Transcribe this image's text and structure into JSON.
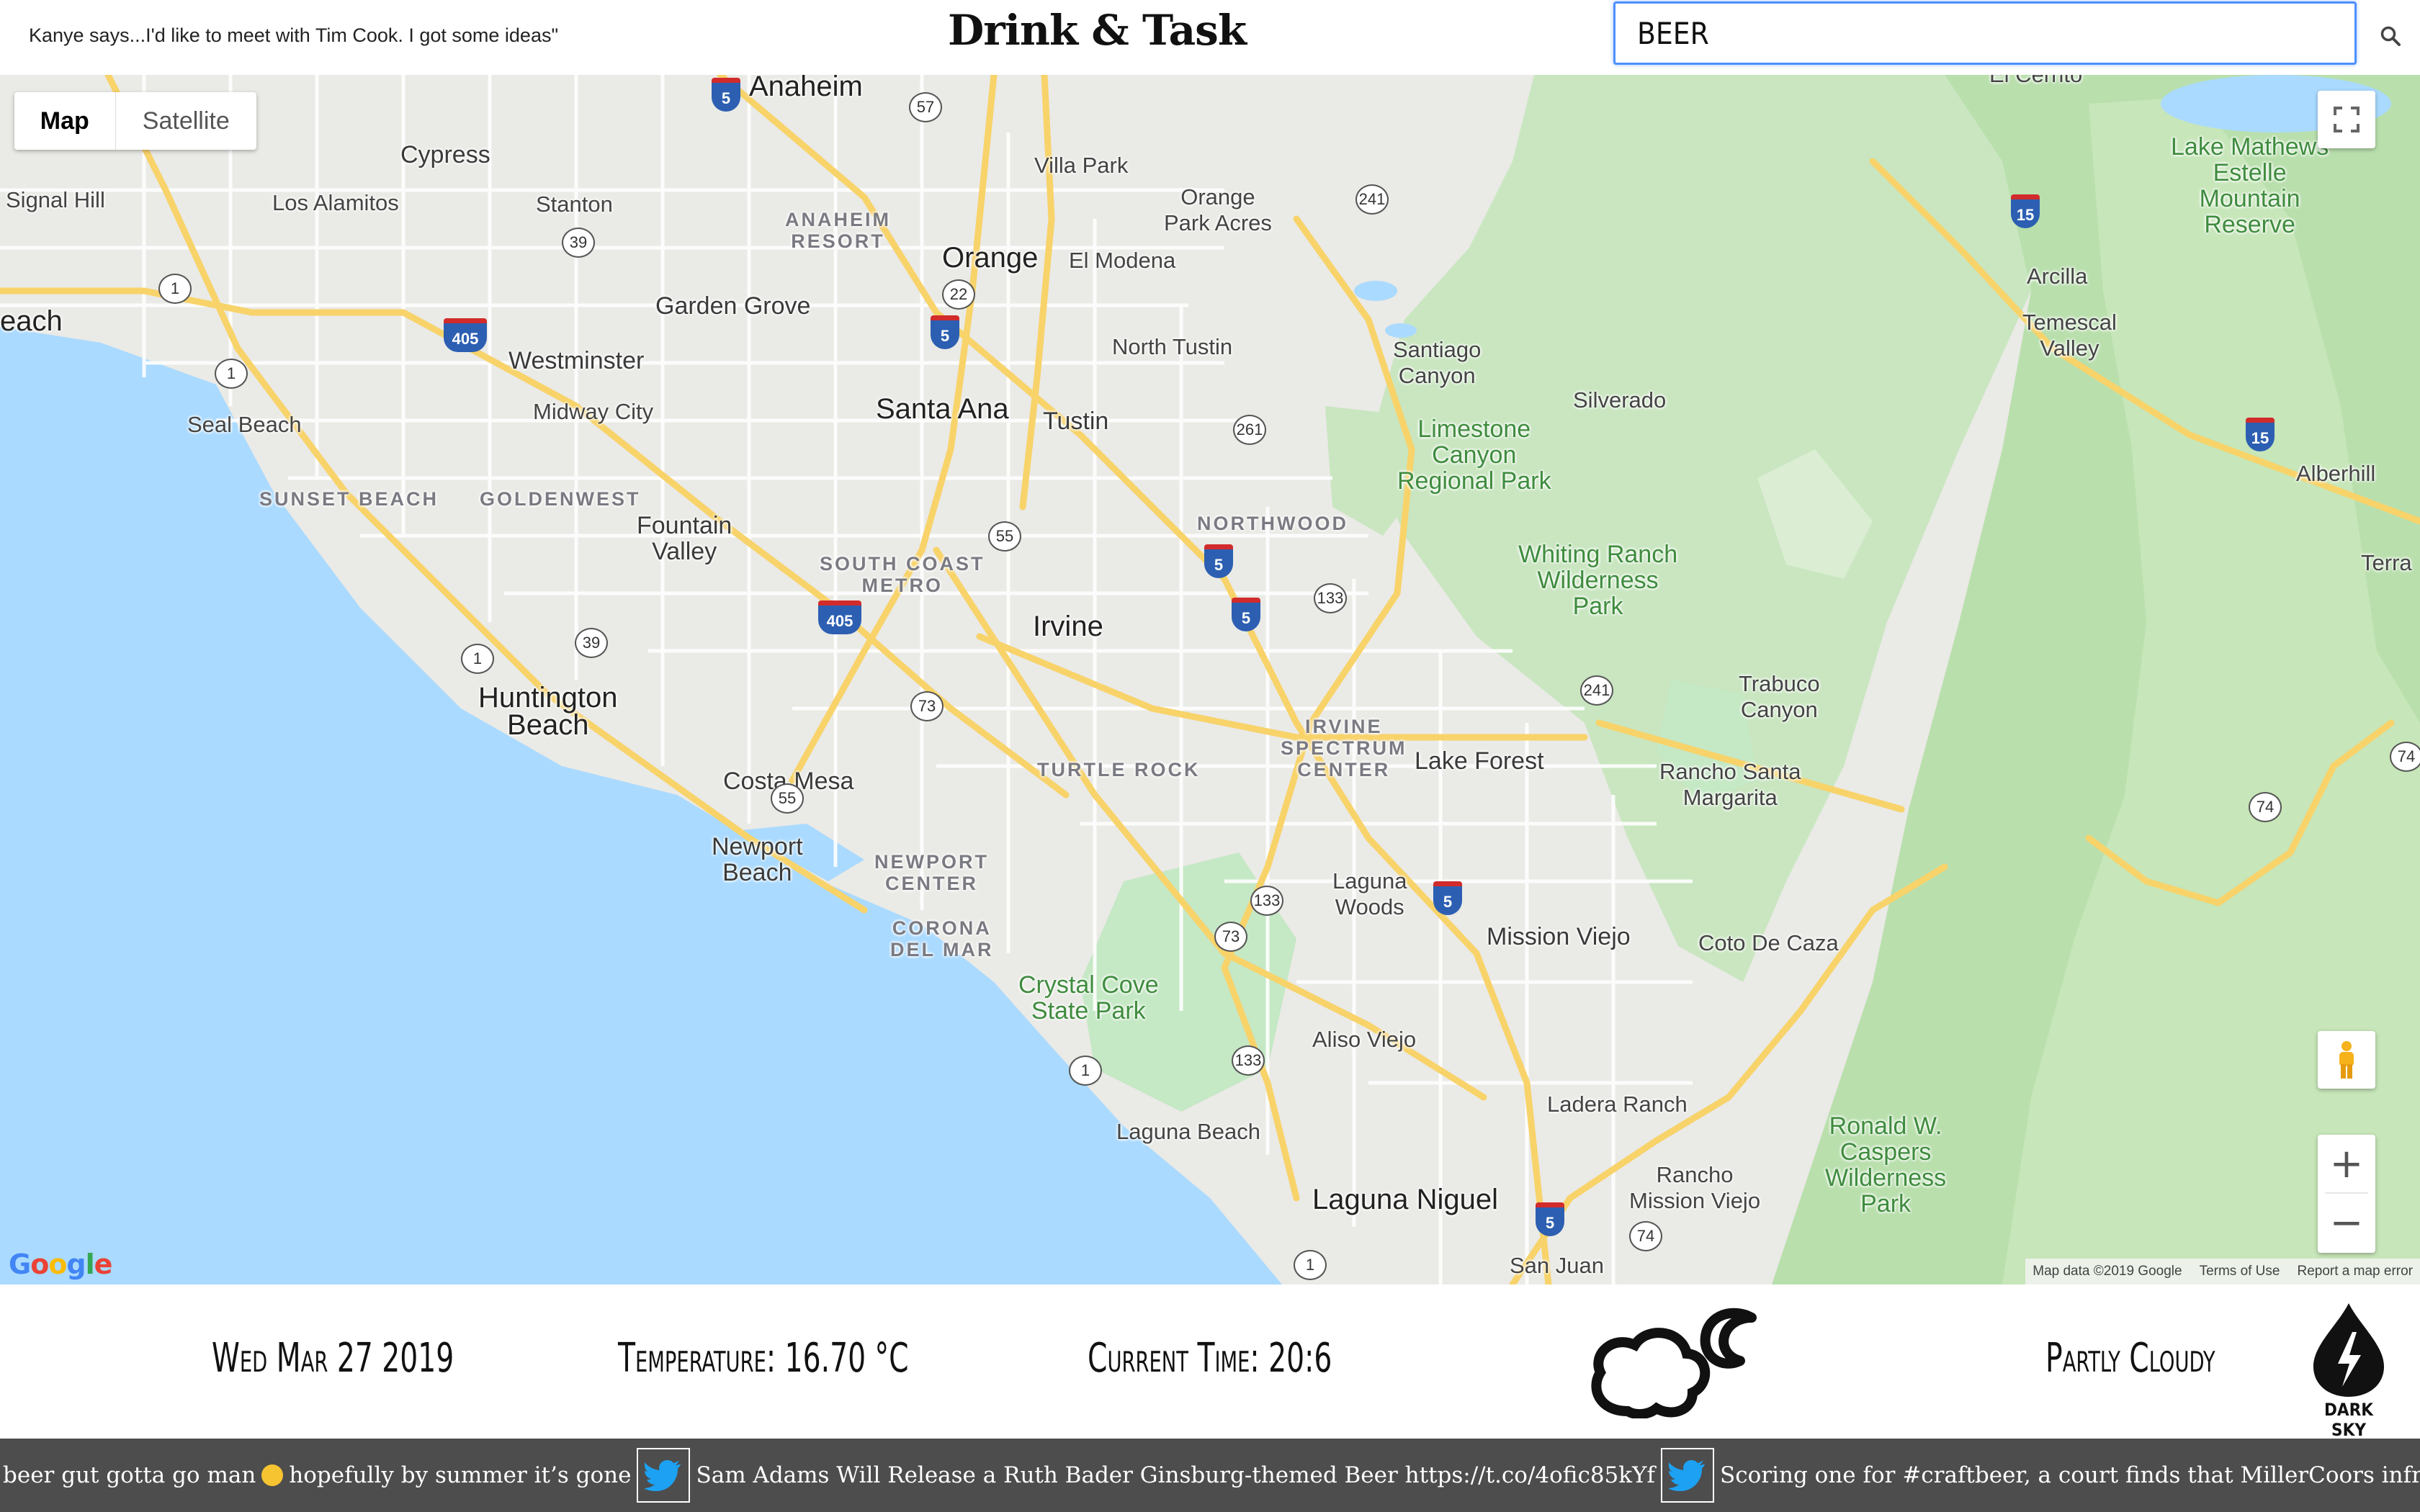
{
  "header": {
    "quote": "Kanye says...I'd like to meet with Tim Cook. I got some ideas\"",
    "title": "Drink & Task",
    "search_value": "BEER",
    "search_icon": "search-icon"
  },
  "map": {
    "type_controls": {
      "map_label": "Map",
      "satellite_label": "Satellite",
      "selected": "Map"
    },
    "places": {
      "anaheim": "Anaheim",
      "cypress": "Cypress",
      "signal_hill": "Signal Hill",
      "los_alamitos": "Los Alamitos",
      "stanton": "Stanton",
      "villa_park": "Villa Park",
      "orange_park_acres": "Orange\nPark Acres",
      "anaheim_resort": "ANAHEIM\nRESORT",
      "orange": "Orange",
      "el_modena": "El Modena",
      "beach_edge": "each",
      "garden_grove": "Garden Grove",
      "north_tustin": "North Tustin",
      "santiago_canyon": "Santiago\nCanyon",
      "westminster": "Westminster",
      "silverado": "Silverado",
      "seal_beach": "Seal Beach",
      "midway_city": "Midway City",
      "santa_ana": "Santa Ana",
      "tustin": "Tustin",
      "limestone_canyon": "Limestone\nCanyon\nRegional Park",
      "sunset_beach": "SUNSET BEACH",
      "goldenwest": "GOLDENWEST",
      "northwood": "NORTHWOOD",
      "fountain_valley": "Fountain\nValley",
      "south_coast_metro": "SOUTH COAST\nMETRO",
      "whiting_ranch": "Whiting Ranch\nWilderness\nPark",
      "irvine": "Irvine",
      "huntington_beach": "Huntington\nBeach",
      "trabuco_canyon": "Trabuco\nCanyon",
      "irvine_spectrum": "IRVINE\nSPECTRUM\nCENTER",
      "lake_forest": "Lake Forest",
      "turtle_rock": "TURTLE ROCK",
      "costa_mesa": "Costa Mesa",
      "rancho_santa_margarita": "Rancho Santa\nMargarita",
      "newport_beach": "Newport\nBeach",
      "newport_center": "NEWPORT\nCENTER",
      "laguna_woods": "Laguna\nWoods",
      "mission_viejo": "Mission Viejo",
      "coto_de_caza": "Coto De Caza",
      "corona_del_mar": "CORONA\nDEL MAR",
      "crystal_cove": "Crystal Cove\nState Park",
      "aliso_viejo": "Aliso Viejo",
      "ladera_ranch": "Ladera Ranch",
      "ronald_caspers": "Ronald W.\nCaspers\nWilderness\nPark",
      "laguna_beach": "Laguna Beach",
      "rancho_mission_viejo": "Rancho\nMission Viejo",
      "laguna_niguel": "Laguna Niguel",
      "san_juan": "San Juan",
      "lake_mathews": "Lake Mathews\nEstelle\nMountain\nReserve",
      "arcilla": "Arcilla",
      "temescal_valley": "Temescal\nValley",
      "alberhill": "Alberhill",
      "terra": "Terra",
      "el_cerrito": "El Cerrito"
    },
    "shields": {
      "i5a": "5",
      "s57": "57",
      "s241a": "241",
      "i15a": "15",
      "s39a": "39",
      "s22": "22",
      "i5b": "5",
      "s1a": "1",
      "i405a": "405",
      "s1b": "1",
      "s261": "261",
      "i15b": "15",
      "s55a": "55",
      "i5c": "5",
      "i5d": "5",
      "s133a": "133",
      "i405b": "405",
      "s39b": "39",
      "s1c": "1",
      "s73a": "73",
      "s241b": "241",
      "s74a": "74",
      "s55b": "55",
      "s74b": "74",
      "i5e": "5",
      "s133b": "133",
      "s73b": "73",
      "s1d": "1",
      "s133c": "133",
      "i5f": "5",
      "s74c": "74",
      "s1e": "1"
    },
    "attribution": {
      "data": "Map data ©2019 Google",
      "terms": "Terms of Use",
      "report": "Report a map error"
    },
    "logo": "Google",
    "icons": {
      "fullscreen": "fullscreen-icon",
      "pegman": "pegman-icon",
      "zoom_in": "+",
      "zoom_out": "−"
    }
  },
  "weather": {
    "date": "Wed Mar 27 2019",
    "temperature": "Temperature: 16.70 °C",
    "current_time": "Current Time: 20:6",
    "summary": "Partly Cloudy",
    "icon": "partly-cloudy-night-icon",
    "powered_by": "DARK SKY"
  },
  "ticker": {
    "items": [
      "beer gut gotta go man",
      "hopefully by summer it’s gone",
      "Sam Adams Will Release a Ruth Bader Ginsburg-themed Beer https://t.co/4ofic85kYf",
      "Scoring one for #craftbeer, a court finds that MillerCoors infringes on STONE® brand, ordering that Stone's"
    ],
    "icon": "twitter-bird-icon"
  },
  "colors": {
    "water": "#aadaff",
    "land": "#eaeae6",
    "park": "#c5e8c5",
    "highway": "#f8d36a",
    "ticker_bg": "#4d4d4d",
    "focus": "#4d90fe"
  }
}
